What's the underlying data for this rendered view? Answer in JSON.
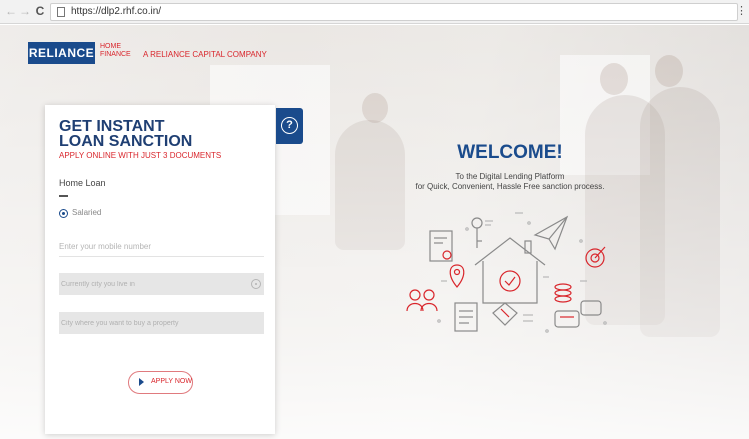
{
  "browser": {
    "back_glyph": "←",
    "forward_glyph": "→",
    "reload_glyph": "C",
    "url": "https://dlp2.rhf.co.in/",
    "menu_glyph": "⋮"
  },
  "logo": {
    "brand": "RELIANCE",
    "sub_line1": "HOME",
    "sub_line2": "FINANCE",
    "tagline": "A RELIANCE CAPITAL COMPANY"
  },
  "form": {
    "headline_line1": "GET INSTANT",
    "headline_line2": "LOAN SANCTION",
    "subheadline": "APPLY ONLINE WITH JUST 3 DOCUMENTS",
    "loan_type": "Home Loan",
    "radio_label": "Salaried",
    "mobile_placeholder": "Enter your mobile number",
    "city_placeholder": "Currently city you live in",
    "property_city_placeholder": "City where you want to buy a property",
    "apply_label": "APPLY NOW",
    "help_glyph": "?"
  },
  "welcome": {
    "title": "WELCOME!",
    "line1": "To the Digital Lending Platform",
    "line2": "for Quick, Convenient, Hassle Free sanction process."
  },
  "colors": {
    "brand_blue": "#1a4b8c",
    "brand_red": "#d9262c",
    "illustration_red": "#d9262c",
    "illustration_gray": "#8a8a8a"
  }
}
